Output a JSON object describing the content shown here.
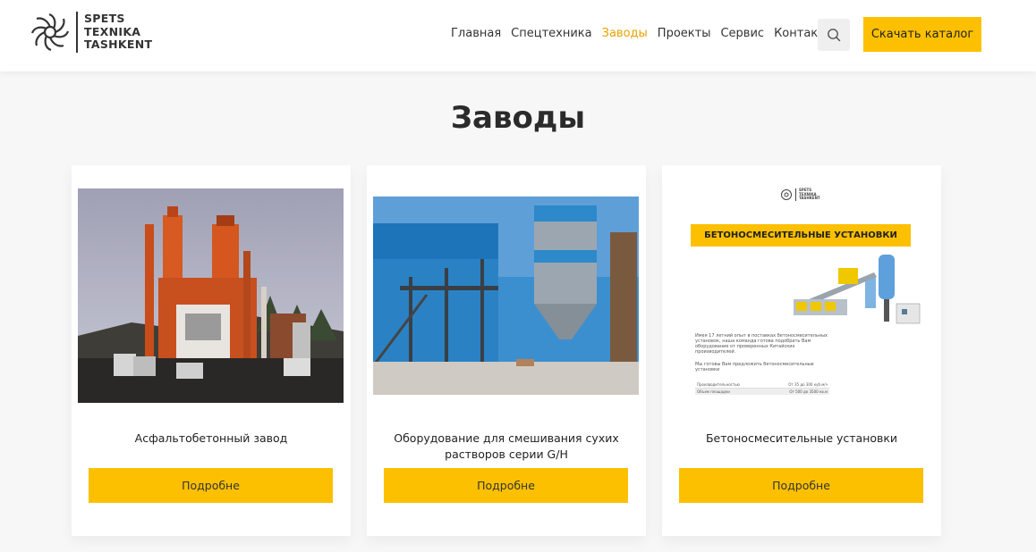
{
  "header": {
    "logo_lines": [
      "SPETS",
      "TEXNIKA",
      "TASHKENT"
    ],
    "nav": [
      {
        "label": "Главная",
        "active": false
      },
      {
        "label": "Спецтехника",
        "active": false
      },
      {
        "label": "Заводы",
        "active": true
      },
      {
        "label": "Проекты",
        "active": false
      },
      {
        "label": "Сервис",
        "active": false
      },
      {
        "label": "Контакты",
        "active": false
      }
    ],
    "catalog_button": "Скачать каталог"
  },
  "page": {
    "title": "Заводы"
  },
  "cards": [
    {
      "title": "Асфальтобетонный завод",
      "button": "Подробне"
    },
    {
      "title": "Оборудование для смешивания сухих растворов серии G/H",
      "button": "Подробне"
    },
    {
      "title": "Бетоносмесительные установки",
      "button": "Подробне",
      "brochure": {
        "logo_lines": [
          "SPETS",
          "TEXNIKA",
          "TASHKENT"
        ],
        "banner": "БЕТОНОСМЕСИТЕЛЬНЫЕ УСТАНОВКИ",
        "text1": "Имея 17 летний опыт в поставках бетоносмесительных установок, наша команда готова подобрать Вам оборудование от проверенных Китайских производителей.",
        "text2": "Мы готовы Вам предложить бетоносмесительные установки",
        "table": [
          [
            "Производительностью",
            "От 35 до 300 куб.м/ч"
          ],
          [
            "Объем площадки",
            "От 500 до 3500 кв.м"
          ]
        ]
      }
    }
  ],
  "colors": {
    "accent": "#fdc000",
    "active_nav": "#e8a200",
    "background": "#f7f7f7"
  }
}
